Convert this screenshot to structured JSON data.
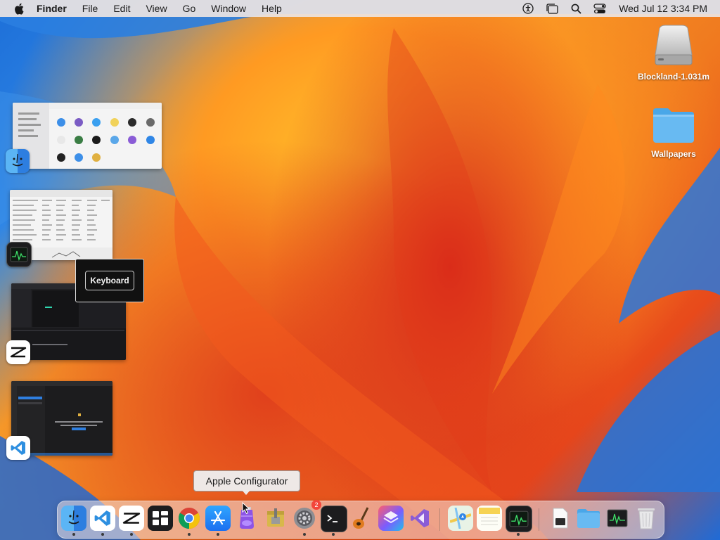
{
  "menubar": {
    "app_name": "Finder",
    "items": [
      "File",
      "Edit",
      "View",
      "Go",
      "Window",
      "Help"
    ],
    "status_icons": [
      "accessibility-icon",
      "stage-manager-icon",
      "spotlight-search-icon",
      "control-center-icon"
    ],
    "clock": "Wed Jul 12  3:34 PM"
  },
  "desktop": {
    "items": [
      {
        "label": "Blockland-1.031m",
        "icon": "disk-drive-icon"
      },
      {
        "label": "Wallpapers",
        "icon": "folder-icon"
      }
    ]
  },
  "windows_strip": {
    "apps": [
      {
        "name": "Finder",
        "icon": "finder-icon"
      },
      {
        "name": "Activity Monitor",
        "icon": "activity-monitor-icon"
      },
      {
        "name": "CapCut",
        "icon": "capcut-icon"
      },
      {
        "name": "Visual Studio Code",
        "icon": "vscode-icon"
      }
    ]
  },
  "keyboard_popup": {
    "label": "Keyboard"
  },
  "dock": {
    "tooltip": "Apple Configurator",
    "items": [
      {
        "name": "Finder",
        "icon": "finder-icon",
        "running": true
      },
      {
        "name": "Visual Studio Code",
        "icon": "vscode-icon",
        "running": true
      },
      {
        "name": "CapCut",
        "icon": "capcut-icon",
        "running": true
      },
      {
        "name": "Mission Control",
        "icon": "mission-control-icon",
        "running": false
      },
      {
        "name": "Google Chrome",
        "icon": "chrome-icon",
        "running": true
      },
      {
        "name": "App Store",
        "icon": "app-store-icon",
        "running": true
      },
      {
        "name": "Apple Configurator",
        "icon": "apple-configurator-icon",
        "running": false
      },
      {
        "name": "Archive Utility",
        "icon": "archive-utility-icon",
        "running": false
      },
      {
        "name": "System Settings",
        "icon": "system-settings-icon",
        "running": true,
        "badge": "2"
      },
      {
        "name": "Terminal",
        "icon": "terminal-icon",
        "running": true
      },
      {
        "name": "GarageBand",
        "icon": "garageband-icon",
        "running": false
      },
      {
        "name": "Shortcuts",
        "icon": "shortcuts-icon",
        "running": false
      },
      {
        "name": "Visual Studio",
        "icon": "visual-studio-icon",
        "running": false
      },
      {
        "name": "Maps",
        "icon": "maps-icon",
        "running": false
      },
      {
        "name": "Notes",
        "icon": "notes-icon",
        "running": false
      },
      {
        "name": "Activity Monitor",
        "icon": "activity-monitor-icon",
        "running": true
      },
      {
        "name": "Preview Document",
        "icon": "document-icon",
        "running": false
      },
      {
        "name": "Downloads Folder",
        "icon": "folder-icon",
        "running": false
      },
      {
        "name": "Activity Monitor Window",
        "icon": "activity-monitor-icon",
        "running": false
      },
      {
        "name": "Trash",
        "icon": "trash-icon",
        "running": false
      }
    ]
  },
  "colors": {
    "menubar_bg": "#ece4e2",
    "accent_blue": "#2f86e6",
    "wallpaper_orange": "#f7a02a",
    "wallpaper_red": "#e0401c",
    "badge_red": "#f3463b"
  }
}
